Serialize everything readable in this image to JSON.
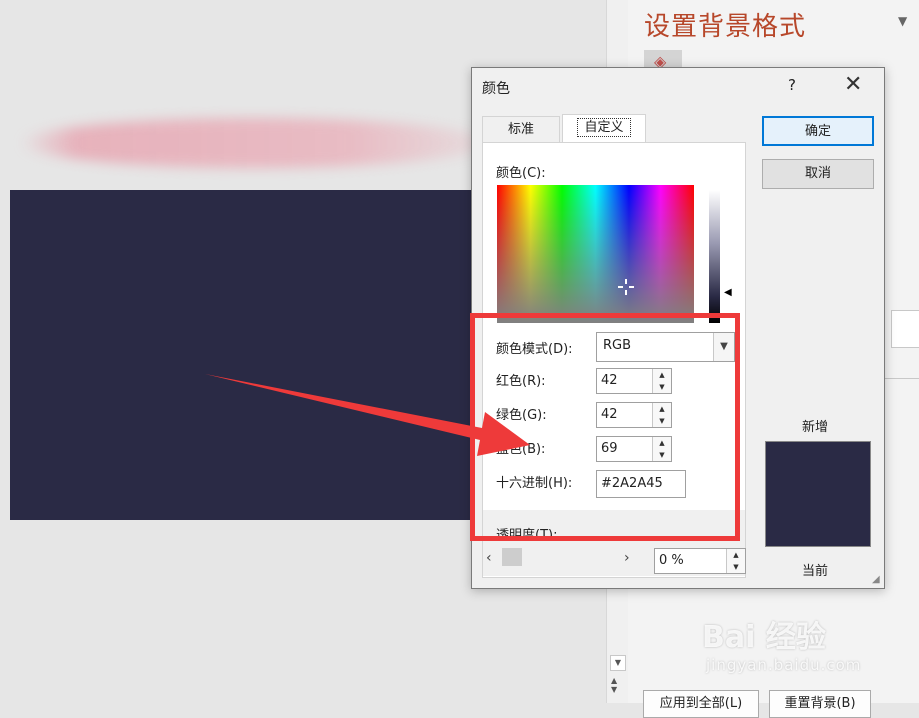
{
  "task_pane": {
    "title": "设置背景格式",
    "apply_all_button": "应用到全部(L)",
    "reset_button": "重置背景(B)"
  },
  "dialog": {
    "title": "颜色",
    "help": "?",
    "close": "✕",
    "tabs": [
      "标准",
      "自定义"
    ],
    "colors_label": "颜色(C):",
    "color_model_label": "颜色模式(D):",
    "color_model_value": "RGB",
    "red_label": "红色(R):",
    "red_value": "42",
    "green_label": "绿色(G):",
    "green_value": "42",
    "blue_label": "蓝色(B):",
    "blue_value": "69",
    "hex_label": "十六进制(H):",
    "hex_value": "#2A2A45",
    "transparency_label": "透明度(T):",
    "transparency_value": "0 %",
    "ok_button": "确定",
    "cancel_button": "取消",
    "new_label": "新增",
    "current_label": "当前"
  },
  "watermark": {
    "logo": "Bai 经验",
    "url": "jingyan.baidu.com"
  },
  "colors": {
    "background_color": "#2a2a45",
    "pane_title_color": "#b7472a",
    "highlight_color": "#ee3a3a"
  }
}
